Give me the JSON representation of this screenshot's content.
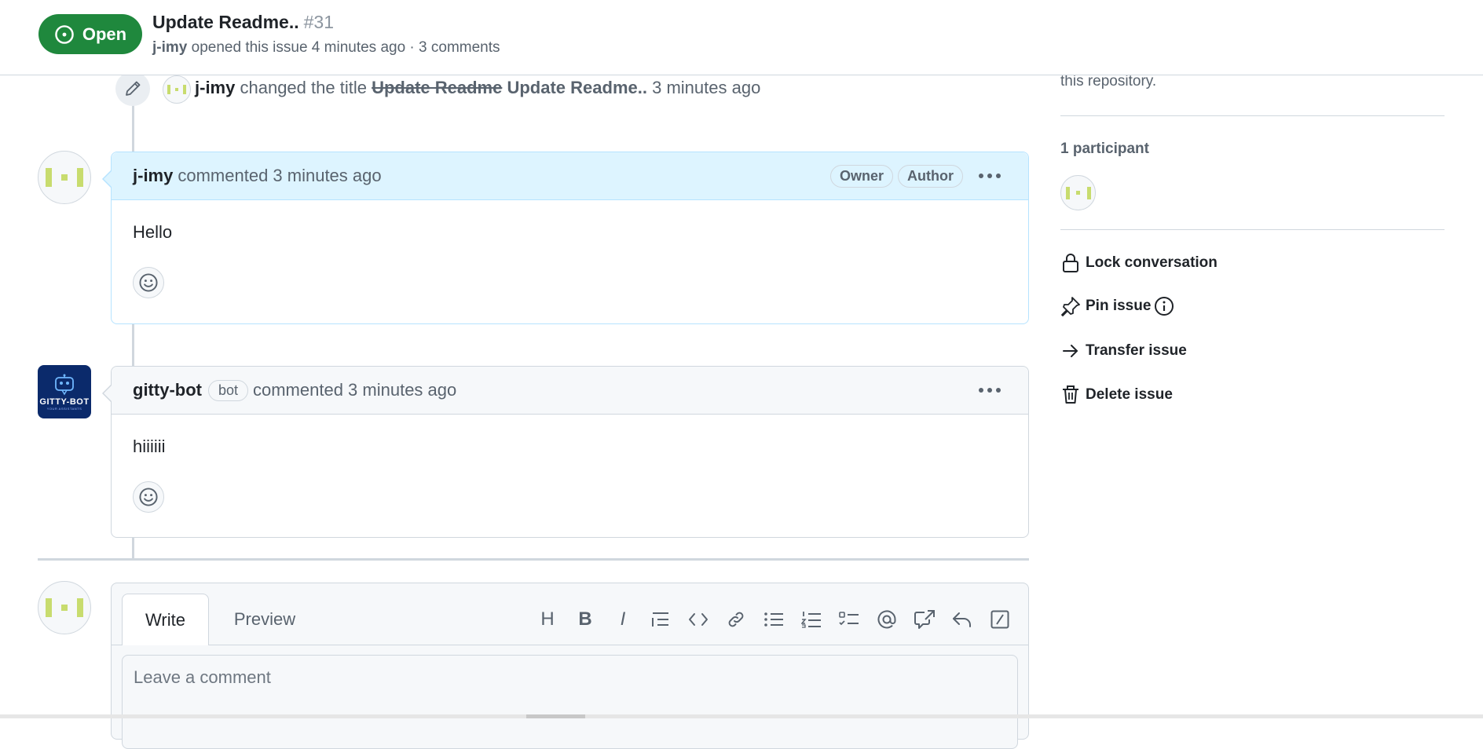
{
  "header": {
    "state_label": "Open",
    "title": "Update Readme..",
    "number": "#31",
    "author": "j-imy",
    "meta": "opened this issue 4 minutes ago · 3 comments"
  },
  "event": {
    "actor": "j-imy",
    "action": "changed the title",
    "old_title": "Update Readme",
    "new_title": "Update Readme..",
    "time": "3 minutes ago"
  },
  "comments": [
    {
      "author": "j-imy",
      "time": "commented 3 minutes ago",
      "labels": [
        "Owner",
        "Author"
      ],
      "body": "Hello"
    },
    {
      "author": "gitty-bot",
      "badge": "bot",
      "time": "commented 3 minutes ago",
      "body": "hiiiiii",
      "avatar_text": "GITTY-BOT",
      "avatar_tagline": "YOUR ASSISTANTS"
    }
  ],
  "composer": {
    "tabs": [
      "Write",
      "Preview"
    ],
    "active_tab": "Write",
    "placeholder": "Leave a comment",
    "value": "",
    "tools": [
      "heading-icon",
      "bold-icon",
      "italic-icon",
      "quote-icon",
      "code-icon",
      "link-icon",
      "unordered-list-icon",
      "ordered-list-icon",
      "task-list-icon",
      "mention-icon",
      "cross-reference-icon",
      "saved-reply-icon",
      "slash-command-icon"
    ],
    "tool_glyphs": {
      "heading": "H",
      "bold": "B",
      "italic": "I"
    }
  },
  "sidebar": {
    "cut_text": "this repository.",
    "participants_heading": "1 participant",
    "actions": [
      {
        "label": "Lock conversation",
        "icon": "lock-icon"
      },
      {
        "label": "Pin issue",
        "icon": "pin-icon",
        "extra_icon": "info-icon"
      },
      {
        "label": "Transfer issue",
        "icon": "arrow-right-icon"
      },
      {
        "label": "Delete issue",
        "icon": "trash-icon"
      }
    ]
  },
  "colors": {
    "open_green": "#1f883d",
    "owner_header": "#ddf4ff",
    "owner_border": "#b6e3ff",
    "avatar_green": "#c8dc6e",
    "bot_navy": "#0b2a6b"
  }
}
